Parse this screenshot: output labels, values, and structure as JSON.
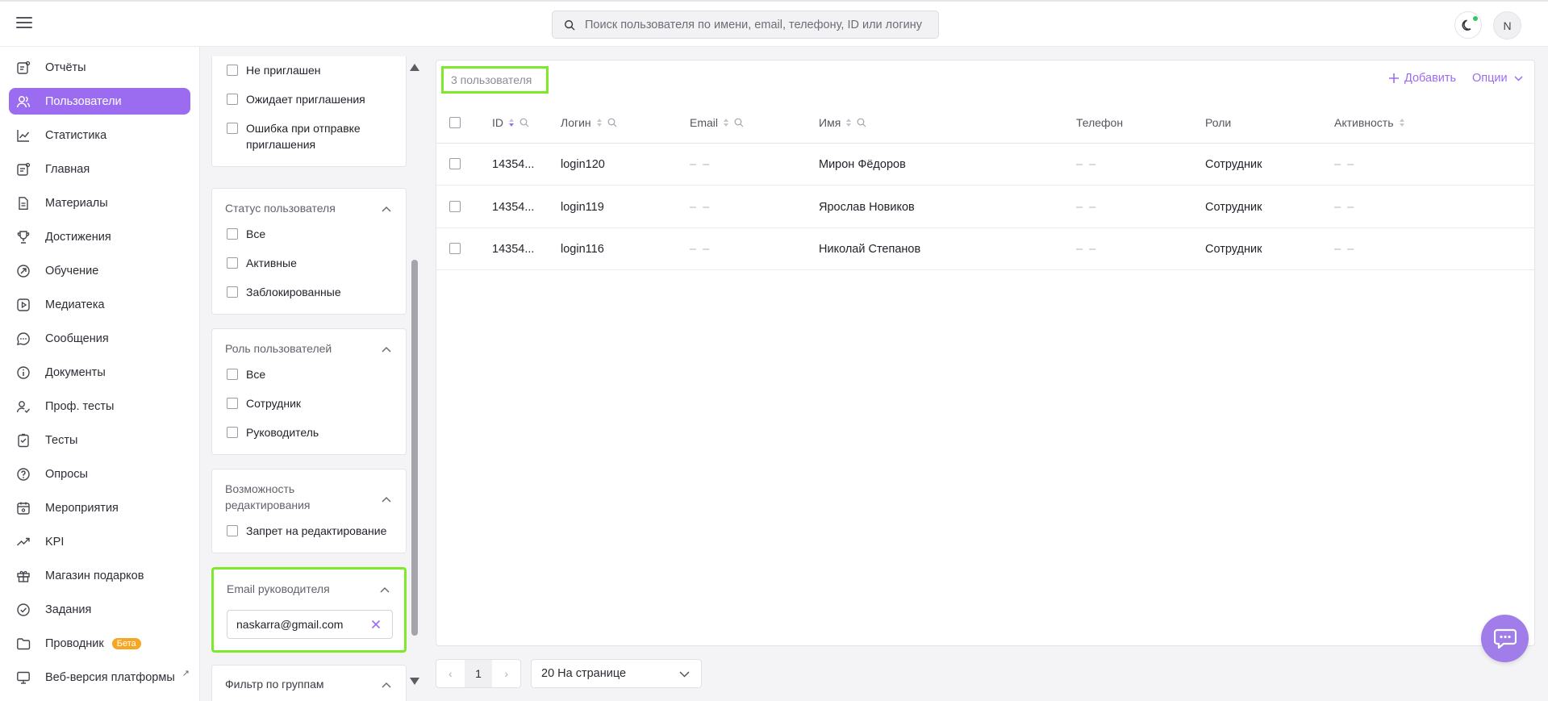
{
  "header": {
    "search_placeholder": "Поиск пользователя по имени, email, телефону, ID или логину",
    "avatar_initial": "N"
  },
  "sidebar": {
    "items": [
      {
        "label": "Отчёты",
        "icon": "report-icon"
      },
      {
        "label": "Пользователи",
        "icon": "users-icon",
        "active": true
      },
      {
        "label": "Статистика",
        "icon": "chart-line-icon"
      },
      {
        "label": "Главная",
        "icon": "home-icon"
      },
      {
        "label": "Материалы",
        "icon": "document-icon"
      },
      {
        "label": "Достижения",
        "icon": "trophy-icon"
      },
      {
        "label": "Обучение",
        "icon": "learning-icon"
      },
      {
        "label": "Медиатека",
        "icon": "media-icon"
      },
      {
        "label": "Сообщения",
        "icon": "chat-icon"
      },
      {
        "label": "Документы",
        "icon": "info-icon"
      },
      {
        "label": "Проф. тесты",
        "icon": "prof-test-icon"
      },
      {
        "label": "Тесты",
        "icon": "test-icon"
      },
      {
        "label": "Опросы",
        "icon": "survey-icon"
      },
      {
        "label": "Мероприятия",
        "icon": "calendar-icon"
      },
      {
        "label": "KPI",
        "icon": "trend-icon"
      },
      {
        "label": "Магазин подарков",
        "icon": "gift-icon"
      },
      {
        "label": "Задания",
        "icon": "check-circle-icon"
      },
      {
        "label": "Проводник",
        "icon": "folder-icon",
        "badge": "Бета"
      },
      {
        "label": "Веб-версия платформы",
        "icon": "monitor-icon",
        "external": "↗"
      }
    ]
  },
  "filters": {
    "invite": {
      "options": [
        "Не приглашен",
        "Ожидает приглашения",
        "Ошибка при отправке приглашения"
      ]
    },
    "status": {
      "title": "Статус пользователя",
      "options": [
        "Все",
        "Активные",
        "Заблокированные"
      ]
    },
    "role": {
      "title": "Роль пользователей",
      "options": [
        "Все",
        "Сотрудник",
        "Руководитель"
      ]
    },
    "edit": {
      "title": "Возможность редактирования",
      "options": [
        "Запрет на редактирование"
      ]
    },
    "manager_email": {
      "title": "Email руководителя",
      "value": "naskarra@gmail.com"
    },
    "groups": {
      "title": "Фильтр по группам"
    }
  },
  "table": {
    "count_label": "3 пользователя",
    "add_label": "Добавить",
    "options_label": "Опции",
    "columns": [
      "ID",
      "Логин",
      "Email",
      "Имя",
      "Телефон",
      "Роли",
      "Активность"
    ],
    "rows": [
      {
        "id": "14354...",
        "login": "login120",
        "email": "– –",
        "name": "Мирон Фёдоров",
        "phone": "– –",
        "role": "Сотрудник",
        "activity": "– –"
      },
      {
        "id": "14354...",
        "login": "login119",
        "email": "– –",
        "name": "Ярослав Новиков",
        "phone": "– –",
        "role": "Сотрудник",
        "activity": "– –"
      },
      {
        "id": "14354...",
        "login": "login116",
        "email": "– –",
        "name": "Николай Степанов",
        "phone": "– –",
        "role": "Сотрудник",
        "activity": "– –"
      }
    ]
  },
  "pagination": {
    "prev": "‹",
    "current_page": "1",
    "next": "›",
    "per_page": "20 На странице"
  },
  "colors": {
    "accent": "#9b6cf0",
    "highlight": "#7ee82a",
    "beta_badge": "#f6a623"
  }
}
